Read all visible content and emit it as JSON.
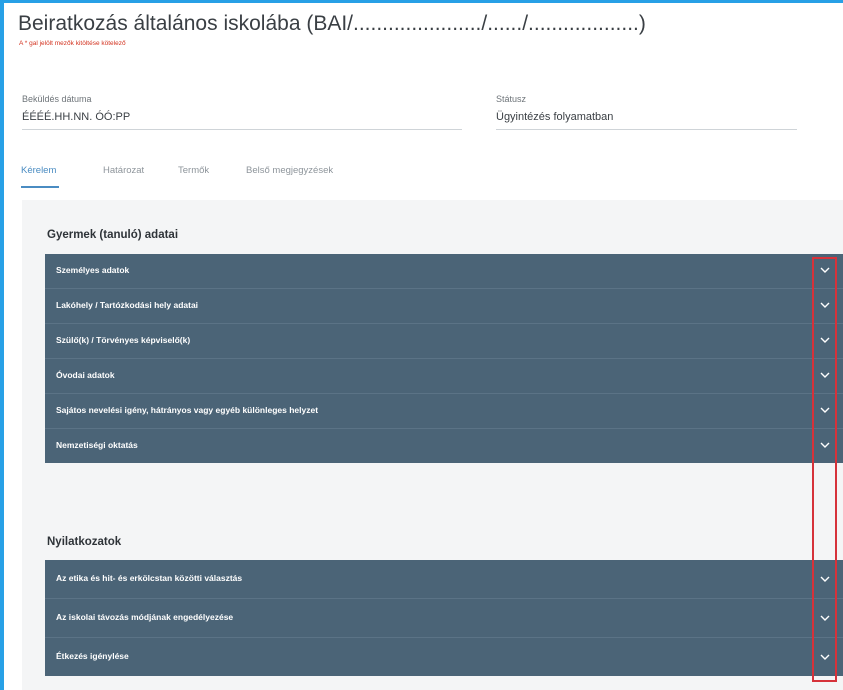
{
  "header": {
    "title": "Beiratkozás általános iskolába (BAI/....................../....../...................)",
    "required_note": "A * gal jelölt mezők kitöltése kötelező"
  },
  "fields": {
    "submit_date": {
      "label": "Beküldés dátuma",
      "value": "ÉÉÉÉ.HH.NN. ÓÓ:PP"
    },
    "status": {
      "label": "Státusz",
      "value": "Ügyintézés folyamatban"
    }
  },
  "tabs": [
    {
      "label": "Kérelem",
      "active": true
    },
    {
      "label": "Határozat",
      "active": false
    },
    {
      "label": "Termők",
      "active": false
    },
    {
      "label": "Belső megjegyzések",
      "active": false
    }
  ],
  "sections": [
    {
      "title": "Gyermek (tanuló) adatai",
      "items": [
        "Személyes adatok",
        "Lakóhely / Tartózkodási hely adatai",
        "Szülő(k) / Törvényes képviselő(k)",
        "Óvodai adatok",
        "Sajátos nevelési igény, hátrányos vagy egyéb különleges helyzet",
        "Nemzetiségi oktatás"
      ]
    },
    {
      "title": "Nyilatkozatok",
      "items": [
        "Az etika és hit- és erkölcstan közötti választás",
        "Az iskolai távozás módjának engedélyezése",
        "Étkezés igénylése"
      ]
    }
  ],
  "colors": {
    "accordion_bg": "#4b6477",
    "accent": "#4a8cc2",
    "frame": "#27a0e6",
    "highlight": "#d6323a"
  },
  "icons": {
    "accordion_toggle": "chevron-down-icon"
  }
}
